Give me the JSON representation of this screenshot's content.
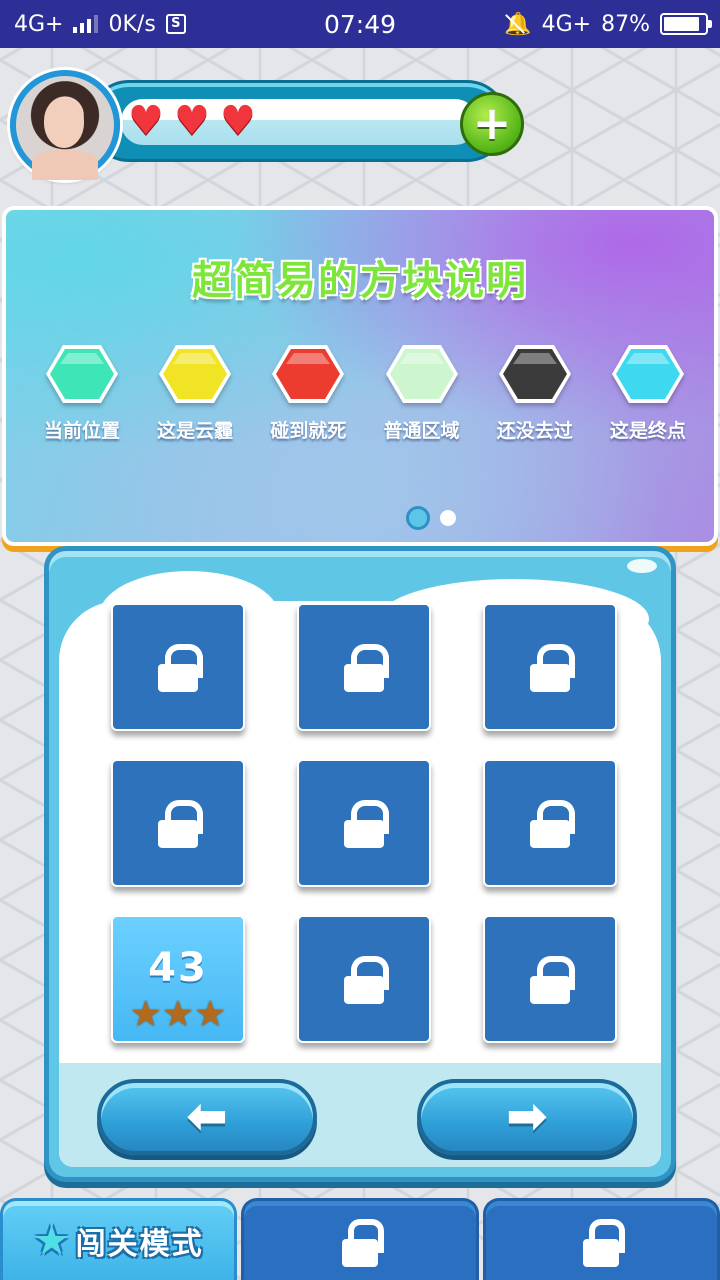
{
  "status_bar": {
    "network_left": "4G+",
    "speed": "0K/s",
    "s_icon": "S",
    "time": "07:49",
    "network_right": "4G+",
    "battery_percent": "87%",
    "battery_level": 0.87
  },
  "profile": {
    "lives": 3,
    "heart_glyph": "♥",
    "add_glyph": "+",
    "icons": [
      "avatar",
      "heart-icon",
      "plus-icon"
    ]
  },
  "banner": {
    "title": "超简易的方块说明",
    "legend": [
      {
        "label": "当前位置",
        "color": "#3ee6b7"
      },
      {
        "label": "这是云霾",
        "color": "#f1e424"
      },
      {
        "label": "碰到就死",
        "color": "#ec3b2f"
      },
      {
        "label": "普通区域",
        "color": "#cdf6cf"
      },
      {
        "label": "还没去过",
        "color": "#3b3b3b"
      },
      {
        "label": "这是终点",
        "color": "#3fd9ef"
      }
    ],
    "page_indicator": {
      "pages": 2,
      "active": 1
    }
  },
  "levels": {
    "tiles": [
      {
        "locked": true
      },
      {
        "locked": true
      },
      {
        "locked": true
      },
      {
        "locked": true
      },
      {
        "locked": true
      },
      {
        "locked": true
      },
      {
        "locked": false,
        "number": "43",
        "stars": 3
      },
      {
        "locked": true
      },
      {
        "locked": true
      }
    ],
    "prev_glyph": "⬅",
    "next_glyph": "➡"
  },
  "tabs": [
    {
      "label": "闯关模式",
      "icon": "star-icon",
      "active": true,
      "star_glyph": "★"
    },
    {
      "label": "",
      "icon": "lock-icon",
      "active": false
    },
    {
      "label": "",
      "icon": "lock-icon",
      "active": false
    }
  ],
  "colors": {
    "status_bar": "#2e2f96",
    "tile_locked": "#2d72bb",
    "tile_open": "#5cc6fb",
    "accent_green": "#7ee63b",
    "panel": "#5fc6e6"
  }
}
